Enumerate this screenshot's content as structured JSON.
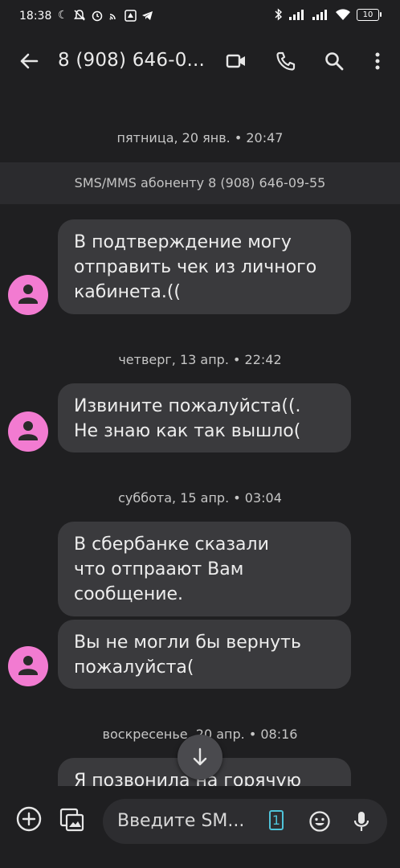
{
  "status_bar": {
    "time": "18:38",
    "battery": "10",
    "left_icons": [
      "moon-icon",
      "bell-off-icon",
      "alarm-icon",
      "cast-icon",
      "app-icon",
      "telegram-icon"
    ],
    "right_icons": [
      "bluetooth-icon",
      "signal-icon",
      "signal-icon",
      "wifi-icon"
    ]
  },
  "header": {
    "contact": "8 (908) 646-0..."
  },
  "thread": {
    "info_banner": "SMS/MMS абоненту 8 (908) 646-09-55",
    "groups": [
      {
        "date": "пятница, 20 янв. • 20:47",
        "messages": [
          [
            "В подтверждение  могу",
            "отправить чек из личного",
            "кабинета.(("
          ]
        ]
      },
      {
        "date": "четверг, 13 апр. • 22:42",
        "messages": [
          [
            "Извините пожалуйста((.",
            "Не знаю как так вышло("
          ]
        ]
      },
      {
        "date": "суббота, 15 апр. • 03:04",
        "messages": [
          [
            "В сбербанке сказали",
            "что отпраают Вам",
            "сообщение."
          ],
          [
            "Вы не могли бы вернуть",
            "пожалуйста("
          ]
        ]
      },
      {
        "date": "воскресенье, 20 апр. • 08:16",
        "messages": [
          [
            "Я позвонила на горячую"
          ]
        ]
      }
    ]
  },
  "compose": {
    "placeholder": "Введите SM...",
    "sim_badge": "1"
  },
  "colors": {
    "background": "#1f1f21",
    "bubble": "#3a3a3d",
    "avatar": "#f27bd1",
    "sim_accent": "#4fc3d9"
  }
}
